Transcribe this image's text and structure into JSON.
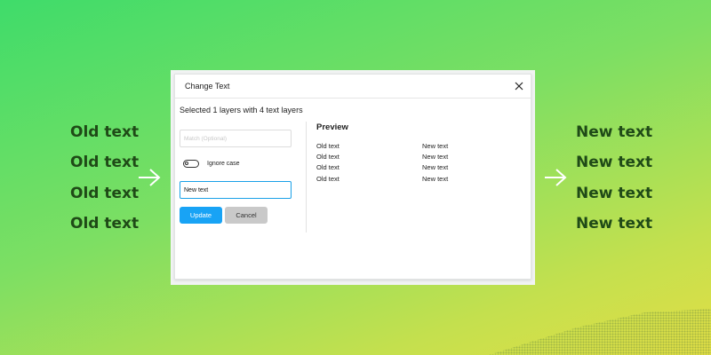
{
  "left_words": [
    "Old text",
    "Old text",
    "Old text",
    "Old text"
  ],
  "right_words": [
    "New text",
    "New text",
    "New text",
    "New text"
  ],
  "colors": {
    "accent": "#18a3f5",
    "word_text": "#1f4a17",
    "cancel_bg": "#c9c9c9"
  },
  "dialog": {
    "title": "Change Text",
    "summary": "Selected 1 layers with 4 text layers",
    "match_placeholder": "Match (Optional)",
    "ignore_case_label": "Ignore case",
    "ignore_case_checked": false,
    "replace_value": "New text",
    "update_label": "Update",
    "cancel_label": "Cancel",
    "preview_title": "Preview",
    "preview_rows": [
      {
        "old": "Old text",
        "new": "New text"
      },
      {
        "old": "Old text",
        "new": "New text"
      },
      {
        "old": "Old text",
        "new": "New text"
      },
      {
        "old": "Old text",
        "new": "New text"
      }
    ]
  },
  "icons": {
    "close": "close-icon",
    "arrow": "arrow-right-icon"
  }
}
